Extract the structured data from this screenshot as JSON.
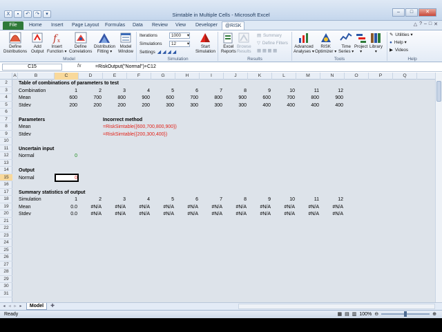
{
  "app": {
    "title": "Simtable in Multiple Cells - Microsoft Excel",
    "window_controls": [
      "–",
      "□",
      "✕"
    ]
  },
  "ribbon_tabs": [
    "File",
    "Home",
    "Insert",
    "Page Layout",
    "Formulas",
    "Data",
    "Review",
    "View",
    "Developer",
    "@RISK"
  ],
  "ribbon_tabs_active": "@RISK",
  "ribbon_right_icons": [
    "△",
    "?",
    "–",
    "□",
    "✕"
  ],
  "ribbon": {
    "model_buttons": [
      {
        "label1": "Define",
        "label2": "Distributions",
        "icon": "distribution-icon"
      },
      {
        "label1": "Add",
        "label2": "Output",
        "icon": "add-output-icon"
      },
      {
        "label1": "Insert",
        "label2": "Function ▾",
        "icon": "function-icon"
      },
      {
        "label1": "Define",
        "label2": "Correlations",
        "icon": "correlations-icon"
      },
      {
        "label1": "Distribution",
        "label2": "Fitting ▾",
        "icon": "fitting-icon"
      },
      {
        "label1": "Model",
        "label2": "Window",
        "icon": "model-window-icon"
      }
    ],
    "model_group": "Model",
    "iterations_label": "Iterations",
    "iterations_value": "1000",
    "simulations_label": "Simulations",
    "simulations_value": "12",
    "settings_label": "Settings",
    "start_simulation": {
      "label1": "Start",
      "label2": "Simulation"
    },
    "simulation_group": "Simulation",
    "excel_reports": {
      "label1": "Excel",
      "label2": "Reports"
    },
    "browse_results": {
      "label1": "Browse",
      "label2": "Results"
    },
    "summary_label": "Summary",
    "define_filters_label": "Define Filters",
    "results_group": "Results",
    "tools_buttons": [
      {
        "label1": "Advanced",
        "label2": "Analyses ▾"
      },
      {
        "label1": "RISK",
        "label2": "Optimizer ▾"
      },
      {
        "label1": "Time",
        "label2": "Series ▾"
      },
      {
        "label1": "Project",
        "label2": "▾"
      },
      {
        "label1": "Library",
        "label2": "▾"
      }
    ],
    "tools_group": "Tools",
    "help_items": [
      "Utilities ▾",
      "Help ▾",
      "Videos"
    ],
    "help_group": "Help"
  },
  "formula_bar": {
    "name_box": "C15",
    "fx": "fx",
    "formula": "=RiskOutput(\"Normal\")+C12"
  },
  "columns": [
    "A",
    "B",
    "C",
    "D",
    "E",
    "F",
    "G",
    "H",
    "I",
    "J",
    "K",
    "L",
    "M",
    "N",
    "O",
    "P",
    "Q"
  ],
  "selected_column": "C",
  "rows": [
    "2",
    "3",
    "4",
    "5",
    "6",
    "7",
    "8",
    "9",
    "10",
    "11",
    "12",
    "13",
    "14",
    "15",
    "16",
    "17",
    "18",
    "19",
    "20",
    "21",
    "22",
    "23",
    "24",
    "25",
    "26",
    "27",
    "28",
    "29",
    "30",
    "31"
  ],
  "selected_row": "15",
  "sheet": {
    "title_combos": "Table of combinations of parameters to test",
    "combination_label": "Combination",
    "combinations": [
      "1",
      "2",
      "3",
      "4",
      "5",
      "6",
      "7",
      "8",
      "9",
      "10",
      "11",
      "12"
    ],
    "mean_label": "Mean",
    "means": [
      "600",
      "700",
      "800",
      "900",
      "600",
      "700",
      "800",
      "900",
      "600",
      "700",
      "800",
      "900"
    ],
    "stdev_label": "Stdev",
    "stdevs": [
      "200",
      "200",
      "200",
      "200",
      "300",
      "300",
      "300",
      "300",
      "400",
      "400",
      "400",
      "400"
    ],
    "parameters_title": "Parameters",
    "param_mean": "Mean",
    "param_stdev": "Stdev",
    "incorrect_title": "Incorrect method",
    "incorrect_f1": "=RiskSimtable({600,700,800,900})",
    "incorrect_f2": "=RiskSimtable({200,300,400})",
    "uncertain_title": "Uncertain input",
    "normal_in_label": "Normal",
    "normal_in_value": "0",
    "output_title": "Output",
    "normal_out_label": "Normal",
    "normal_out_value": "0",
    "summary_title": "Summary statistics of output",
    "simulation_label": "Simulation",
    "simulations": [
      "1",
      "2",
      "3",
      "4",
      "5",
      "6",
      "7",
      "8",
      "9",
      "10",
      "11",
      "12"
    ],
    "sum_mean_label": "Mean",
    "sum_means": [
      "0.0",
      "#N/A",
      "#N/A",
      "#N/A",
      "#N/A",
      "#N/A",
      "#N/A",
      "#N/A",
      "#N/A",
      "#N/A",
      "#N/A",
      "#N/A"
    ],
    "sum_stdev_label": "Stdev",
    "sum_stdevs": [
      "0.0",
      "#N/A",
      "#N/A",
      "#N/A",
      "#N/A",
      "#N/A",
      "#N/A",
      "#N/A",
      "#N/A",
      "#N/A",
      "#N/A",
      "#N/A"
    ]
  },
  "sheet_tabs": [
    "Model"
  ],
  "status": {
    "ready": "Ready",
    "zoom": "100%"
  }
}
